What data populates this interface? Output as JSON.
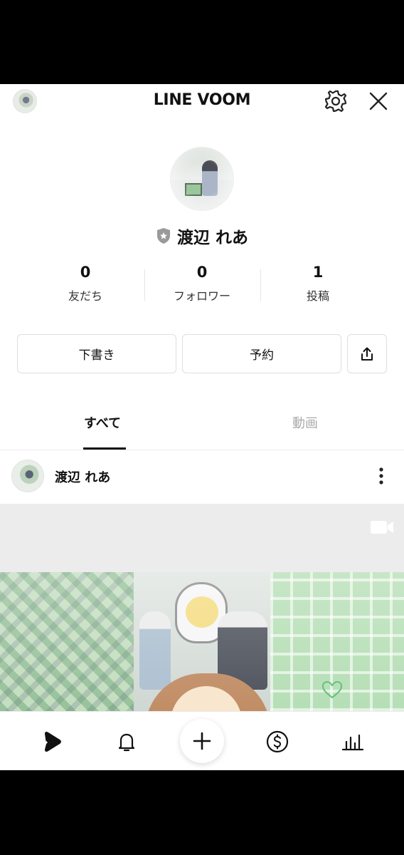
{
  "header": {
    "title": "LINE VOOM",
    "avatar_icon": "profile-avatar",
    "settings_icon": "gear-icon",
    "close_icon": "close-icon"
  },
  "profile": {
    "name": "渡辺 れあ",
    "badge_icon": "shield-star-icon"
  },
  "stats": [
    {
      "value": "0",
      "label": "友だち"
    },
    {
      "value": "0",
      "label": "フォロワー"
    },
    {
      "value": "1",
      "label": "投稿"
    }
  ],
  "actions": {
    "draft_label": "下書き",
    "schedule_label": "予約",
    "share_icon": "share-icon"
  },
  "tabs": [
    {
      "label": "すべて",
      "active": true
    },
    {
      "label": "動画",
      "active": false
    }
  ],
  "post": {
    "author": "渡辺 れあ",
    "menu_icon": "kebab-icon",
    "media_icon": "video-camera-icon"
  },
  "nav": [
    {
      "name": "voom-play-icon",
      "active": true
    },
    {
      "name": "bell-icon"
    },
    {
      "name": "plus-icon"
    },
    {
      "name": "dollar-coin-icon"
    },
    {
      "name": "bar-chart-icon"
    }
  ],
  "colors": {
    "text": "#111111",
    "muted_tab": "#aaaaaa",
    "border": "#dedede"
  }
}
